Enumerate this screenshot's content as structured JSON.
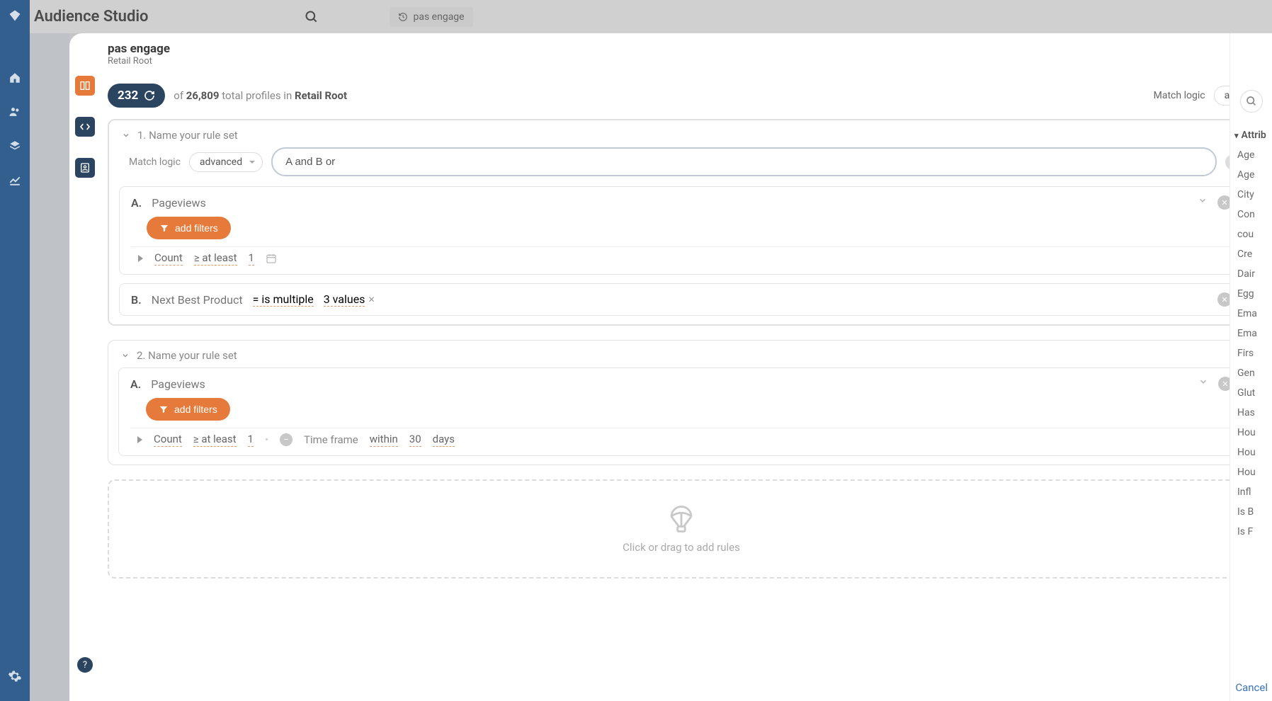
{
  "topbar": {
    "title": "Audience Studio",
    "tab_label": "pas engage"
  },
  "modal": {
    "name": "pas engage",
    "root": "Retail Root",
    "count": "232",
    "total": "26,809",
    "total_prefix": "of",
    "total_mid": "total profiles in",
    "root_name": "Retail Root",
    "match_logic_label": "Match logic",
    "match_logic_value": "all",
    "cancel": "Cancel"
  },
  "ruleset1": {
    "title": "1. Name your rule set",
    "match_logic_label": "Match logic",
    "match_logic_select": "advanced",
    "expression": "A and B or",
    "ruleA": {
      "letter": "A.",
      "name": "Pageviews",
      "add_filters": "add filters",
      "count_label": "Count",
      "op": "≥ at least",
      "value": "1"
    },
    "ruleB": {
      "letter": "B.",
      "name": "Next Best Product",
      "op": "= is multiple",
      "values_label": "3 values"
    }
  },
  "ruleset2": {
    "title": "2. Name your rule set",
    "ruleA": {
      "letter": "A.",
      "name": "Pageviews",
      "add_filters": "add filters",
      "count_label": "Count",
      "op": "≥ at least",
      "value": "1",
      "timeframe_label": "Time frame",
      "within": "within",
      "num": "30",
      "unit": "days"
    }
  },
  "dropzone": {
    "text": "Click or drag to add rules"
  },
  "attributes": {
    "header": "Attrib",
    "items": [
      "Age",
      "Age",
      "City",
      "Con",
      "cou",
      "Cre",
      "Dair",
      "Egg",
      "Ema",
      "Ema",
      "Firs",
      "Gen",
      "Glut",
      "Has",
      "Hou",
      "Hou",
      "Hou",
      "Infl",
      "Is B",
      "Is F"
    ]
  }
}
